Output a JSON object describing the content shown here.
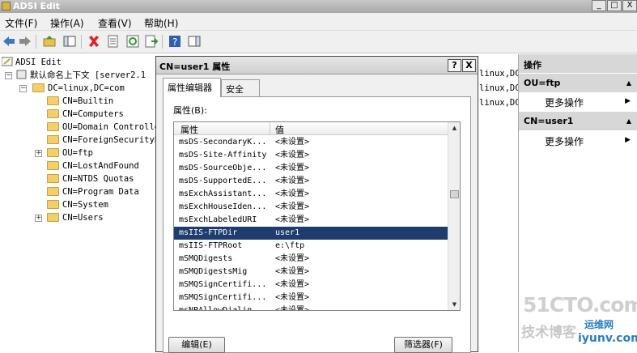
{
  "window": {
    "title": "ADSI Edit",
    "min": "_",
    "max": "□",
    "close": "X"
  },
  "menu": {
    "items": [
      "文件(F)",
      "操作(A)",
      "查看(V)",
      "帮助(H)"
    ]
  },
  "tree": {
    "root": "ADSI Edit",
    "context": "默认命名上下文 [server2.1",
    "domain": "DC=linux,DC=com",
    "nodes": [
      "CN=Builtin",
      "CN=Computers",
      "OU=Domain Controlle",
      "CN=ForeignSecurityP",
      "OU=ftp",
      "CN=LostAndFound",
      "CN=NTDS Quotas",
      "CN=Program Data",
      "CN=System",
      "CN=Users"
    ]
  },
  "background_list": [
    "linux,DC",
    "linux,DC",
    "linux,DC"
  ],
  "actions": {
    "header": "操作",
    "groups": [
      {
        "title": "OU=ftp",
        "item": "更多操作"
      },
      {
        "title": "CN=user1",
        "item": "更多操作"
      }
    ]
  },
  "dialog": {
    "title": "CN=user1 属性",
    "help_button": "?",
    "close_button": "X",
    "tabs": [
      "属性编辑器",
      "安全"
    ],
    "attributes_label": "属性(B):",
    "columns": [
      "属性",
      "值"
    ],
    "rows": [
      {
        "name": "msDS-SecondaryK...",
        "value": "<未设置>"
      },
      {
        "name": "msDS-Site-Affinity",
        "value": "<未设置>"
      },
      {
        "name": "msDS-SourceObje...",
        "value": "<未设置>"
      },
      {
        "name": "msDS-SupportedE...",
        "value": "<未设置>"
      },
      {
        "name": "msExchAssistant...",
        "value": "<未设置>"
      },
      {
        "name": "msExchHouseIden...",
        "value": "<未设置>"
      },
      {
        "name": "msExchLabeledURI",
        "value": "<未设置>"
      },
      {
        "name": "msIIS-FTPDir",
        "value": "user1"
      },
      {
        "name": "msIIS-FTPRoot",
        "value": "e:\\ftp"
      },
      {
        "name": "mSMQDigests",
        "value": "<未设置>"
      },
      {
        "name": "mSMQDigestsMig",
        "value": "<未设置>"
      },
      {
        "name": "mSMQSignCertifi...",
        "value": "<未设置>"
      },
      {
        "name": "mSMQSignCertifi...",
        "value": "<未设置>"
      },
      {
        "name": "msNPAllowDialin",
        "value": "<未设置>"
      }
    ],
    "selected_row_index": 7,
    "edit_button": "编辑(E)",
    "filter_button": "筛选器(F)"
  },
  "watermark": {
    "line1": "51CTO.com",
    "line2": "技术博客",
    "line3": "运维网",
    "line4": "iyunv.com"
  },
  "colors": {
    "selection": "#1e3c6e",
    "action_header": "#d7d7d7"
  }
}
